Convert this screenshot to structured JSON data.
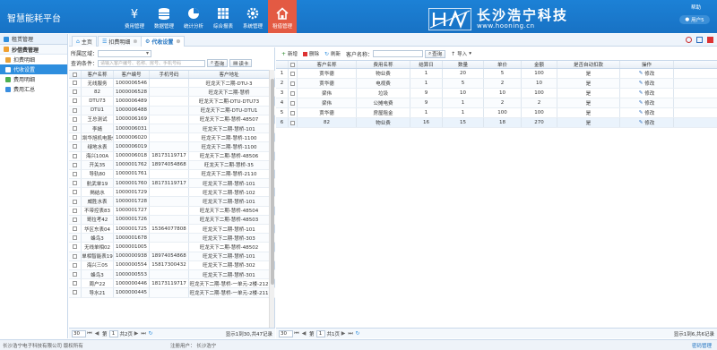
{
  "app": {
    "title": "智慧能耗平台"
  },
  "nav": [
    {
      "label": "费用管理",
      "icon": "yen-icon"
    },
    {
      "label": "数据管理",
      "icon": "database-icon"
    },
    {
      "label": "统计分析",
      "icon": "pie-chart-icon"
    },
    {
      "label": "综合报表",
      "icon": "table-icon"
    },
    {
      "label": "系统管理",
      "icon": "gear-icon"
    },
    {
      "label": "租借管理",
      "icon": "home-icon",
      "active": true
    }
  ],
  "brand": {
    "logo_text": "HN",
    "name": "长沙浩宁科技",
    "url": "www.hooning.cn"
  },
  "header": {
    "help": "帮助",
    "user": "用户5"
  },
  "sidebar": {
    "title": "租赁管理",
    "section": "抄借费管理",
    "items": [
      {
        "label": "扣费明细",
        "color": "#e8a33a"
      },
      {
        "label": "代收设置",
        "color": "#ffffff",
        "active": true
      },
      {
        "label": "费用明细",
        "color": "#4caf50"
      },
      {
        "label": "费用汇总",
        "color": "#3a8ee0"
      }
    ]
  },
  "tabs": [
    {
      "label": "主页"
    },
    {
      "label": "扣费明细"
    },
    {
      "label": "代收设置",
      "active": true
    }
  ],
  "left": {
    "region_label": "所属区域：",
    "search_label": "查询条件：",
    "search_placeholder": "请输入客户编号、名称、房号、手机号码",
    "query_btn": "查询",
    "read_card_btn": "读卡",
    "columns": [
      "",
      "客户名称",
      "客户编号",
      "手机号码",
      "客户地址"
    ],
    "rows": [
      [
        "无线服务",
        "1000006546",
        "",
        "旺龙天下二期-DTU-3"
      ],
      [
        "82",
        "1000006528",
        "",
        "旺龙天下二期-慧桥"
      ],
      [
        "DTU73",
        "1000006489",
        "",
        "旺龙天下二期-DTU-DTU73"
      ],
      [
        "DTU1",
        "1000006488",
        "",
        "旺龙天下二期-DTU-DTU1"
      ],
      [
        "王总测试",
        "1000006169",
        "",
        "旺龙天下二期-慧桥-48507"
      ],
      [
        "李婧",
        "1000006031",
        "",
        "旺龙天下二期-慧桥-101"
      ],
      [
        "深圳华旭机电股份",
        "1000006020",
        "",
        "旺龙天下二期-慧桥-1100"
      ],
      [
        "绿地水表",
        "1000006019",
        "",
        "旺龙天下二期-慧桥-1100"
      ],
      [
        "海兴100A",
        "1000006018",
        "18173119717",
        "旺龙天下二期-慧桥-48506"
      ],
      [
        "开关35",
        "1000001762",
        "18974054868",
        "旺龙天下二期-慧桥-35"
      ],
      [
        "导轨80",
        "1000001761",
        "",
        "旺龙天下二期-慧桥-2110"
      ],
      [
        "航武单19",
        "1000001760",
        "18173119717",
        "旺龙天下二期-慧桥-101"
      ],
      [
        "揭结水",
        "1000001729",
        "",
        "旺龙天下二期-慧桥-102"
      ],
      [
        "威胜水表",
        "1000001728",
        "",
        "旺龙天下二期-慧桥-101"
      ],
      [
        "不带控表83",
        "1000001727",
        "",
        "旺龙天下二期-慧桥-48504"
      ],
      [
        "哥拉考42",
        "1000001726",
        "",
        "旺龙天下二期-慧桥-48503"
      ],
      [
        "华区东表04",
        "1000001725",
        "15364077808",
        "旺龙天下二期-慧桥-101"
      ],
      [
        "蜂鸟3",
        "1000001678",
        "",
        "旺龙天下二期-慧桥-303"
      ],
      [
        "无线单相02",
        "1000001005",
        "",
        "旺龙天下二期-慧桥-48502"
      ],
      [
        "单相智能表19",
        "1000000938",
        "18974054868",
        "旺龙天下二期-慧桥-101"
      ],
      [
        "海兴三05",
        "1000000554",
        "15817300432",
        "旺龙天下二期-慧桥-302"
      ],
      [
        "蜂鸟3",
        "1000000553",
        "",
        "旺龙天下二期-慧桥-301"
      ],
      [
        "周户22",
        "1000000446",
        "18173119717",
        "旺龙天下二期-慧桥-一单元-2楼-212"
      ],
      [
        "导水21",
        "1000000445",
        "",
        "旺龙天下二期-慧桥-一单元-2楼-211"
      ]
    ],
    "pager": {
      "size": "30",
      "page": "1",
      "of": "共2页",
      "info": "显示1到30,共47记录"
    }
  },
  "right": {
    "toolbar": [
      {
        "label": "新增",
        "icon": "plus-icon"
      },
      {
        "label": "删除",
        "icon": "trash-icon"
      },
      {
        "label": "刷新",
        "icon": "refresh-icon"
      }
    ],
    "name_label": "客户名称：",
    "query_btn": "查询",
    "import_btn": "导入",
    "columns": [
      "",
      "",
      "客户名称",
      "费用名称",
      "结算日",
      "数量",
      "单价",
      "金额",
      "是否自动扣款",
      "操作"
    ],
    "rows": [
      [
        "1",
        "贾华德",
        "物业费",
        "1",
        "20",
        "5",
        "100",
        "是",
        "修改"
      ],
      [
        "2",
        "贾华德",
        "电视费",
        "1",
        "5",
        "2",
        "10",
        "是",
        "修改"
      ],
      [
        "3",
        "梁伟",
        "垃圾",
        "9",
        "10",
        "10",
        "100",
        "是",
        "修改"
      ],
      [
        "4",
        "梁伟",
        "公摊电费",
        "9",
        "1",
        "2",
        "2",
        "是",
        "修改"
      ],
      [
        "5",
        "贾华德",
        "房屋租金",
        "1",
        "1",
        "100",
        "100",
        "是",
        "修改"
      ],
      [
        "6",
        "82",
        "物业费",
        "16",
        "15",
        "18",
        "270",
        "是",
        "修改"
      ]
    ],
    "pager": {
      "size": "30",
      "page": "1",
      "of": "共1页",
      "info": "显示1到6,共6记录"
    }
  },
  "footer": {
    "copyright": "长沙浩宁电子科技有限公司 版权所有",
    "registrant": "注册用户：",
    "registrant_name": "长沙浩宁",
    "manage": "密码管理"
  }
}
